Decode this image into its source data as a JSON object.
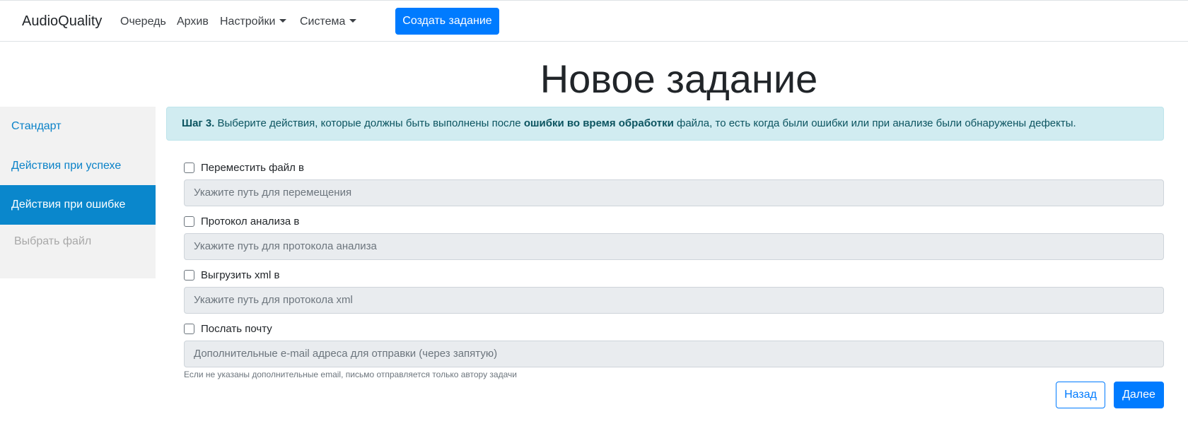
{
  "navbar": {
    "brand": "AudioQuality",
    "links": {
      "queue": "Очередь",
      "archive": "Архив",
      "settings": "Настройки",
      "system": "Система"
    },
    "create_button": "Создать задание"
  },
  "page": {
    "title": "Новое задание"
  },
  "sidebar": {
    "items": [
      {
        "label": "Стандарт",
        "state": "link"
      },
      {
        "label": "Действия при успехе",
        "state": "link"
      },
      {
        "label": "Действия при ошибке",
        "state": "active"
      },
      {
        "label": "Выбрать файл",
        "state": "disabled"
      }
    ]
  },
  "alert": {
    "step": "Шаг 3.",
    "text_before": " Выберите действия, которые должны быть выполнены после ",
    "emphasis": "ошибки во время обработки",
    "text_after": " файла, то есть когда были ошибки или при анализе были обнаружены дефекты."
  },
  "form": {
    "move_file": {
      "label": "Переместить файл в",
      "checked": false,
      "placeholder": "Укажите путь для перемещения"
    },
    "analysis_protocol": {
      "label": "Протокол анализа в",
      "checked": false,
      "placeholder": "Укажите путь для протокола анализа"
    },
    "export_xml": {
      "label": "Выгрузить xml в",
      "checked": false,
      "placeholder": "Укажите путь для протокола xml"
    },
    "send_mail": {
      "label": "Послать почту",
      "checked": false,
      "placeholder": "Дополнительные e-mail адреса для отправки (через запятую)",
      "help": "Если не указаны дополнительные email, письмо отправляется только автору задачи"
    }
  },
  "buttons": {
    "back": "Назад",
    "next": "Далее"
  },
  "colors": {
    "primary": "#007bff",
    "sidebar_active": "#0a87cc",
    "sidebar_bg": "#f2f2f2",
    "alert_bg": "#d1ecf1",
    "alert_text": "#0c5460",
    "input_bg": "#e9ecef"
  }
}
